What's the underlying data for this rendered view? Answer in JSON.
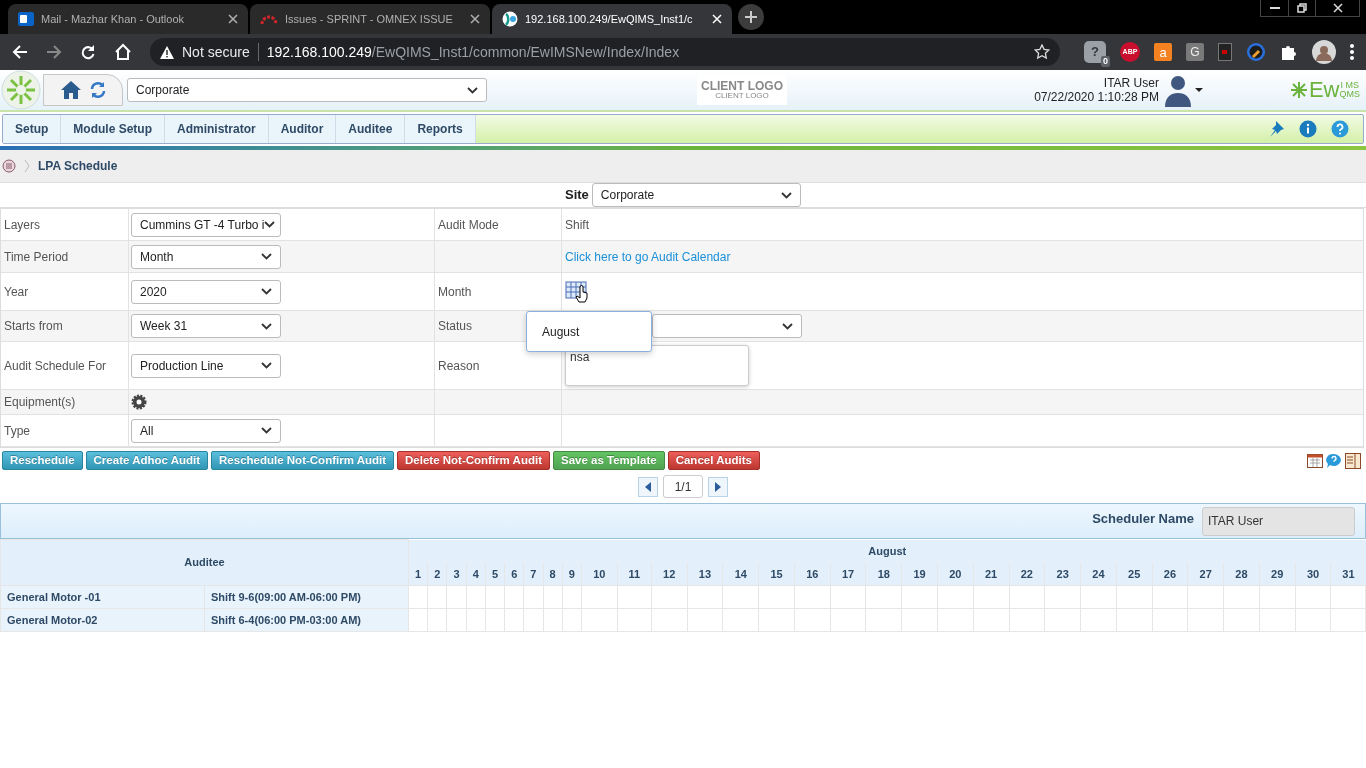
{
  "browser": {
    "tabs": [
      {
        "title": "Mail - Mazhar Khan - Outlook",
        "selected": false,
        "kind": "mail"
      },
      {
        "title": "Issues - SPRINT - OMNEX ISSUE",
        "selected": false,
        "kind": "gauge"
      },
      {
        "title": "192.168.100.249/EwQIMS_Inst1/c",
        "selected": true,
        "kind": "globe"
      }
    ],
    "security": "Not secure",
    "host": "192.168.100.249",
    "path": "/EwQIMS_Inst1/common/EwIMSNew/Index/Index",
    "extensions": [
      {
        "kind": "shield",
        "label": "?",
        "badge": "0"
      },
      {
        "kind": "red",
        "label": "ABP"
      },
      {
        "kind": "orange",
        "label": "a"
      },
      {
        "kind": "gray",
        "label": "G"
      },
      {
        "kind": "doc"
      },
      {
        "kind": "broom"
      },
      {
        "kind": "puzzle"
      },
      {
        "kind": "avatar"
      }
    ]
  },
  "header": {
    "site": "Corporate",
    "client_logo": "CLIENT LOGO",
    "client_logo_sub": "CLIENT LOGO",
    "user": "ITAR User",
    "datetime": "07/22/2020 1:10:28 PM",
    "brand": "Ew",
    "brand_top": "I MS",
    "brand_bottom": "QMS"
  },
  "menu": [
    "Setup",
    "Module Setup",
    "Administrator",
    "Auditor",
    "Auditee",
    "Reports"
  ],
  "breadcrumb": "LPA Schedule",
  "form": {
    "site_label": "Site",
    "site_value": "Corporate",
    "rows": [
      {
        "label": "Layers",
        "field": {
          "kind": "select",
          "value": "Cummins GT -4 Turbo i"
        },
        "label2": "Audit Mode",
        "field2": {
          "kind": "text",
          "value": "Shift"
        }
      },
      {
        "label": "Time Period",
        "field": {
          "kind": "select",
          "value": "Month"
        },
        "field2": {
          "kind": "link",
          "value": "Click here to go Audit Calendar"
        }
      },
      {
        "label": "Year",
        "field": {
          "kind": "select",
          "value": "2020"
        },
        "label2": "Month",
        "field2": {
          "kind": "calendar"
        }
      },
      {
        "label": "Starts from",
        "field": {
          "kind": "select",
          "value": "Week 31"
        },
        "label2": "Status",
        "field2": {
          "kind": "select"
        }
      },
      {
        "label": "Audit Schedule For",
        "field": {
          "kind": "select",
          "value": "Production Line"
        },
        "label2": "Reason",
        "field2": {
          "kind": "textarea",
          "value": "nsa"
        }
      },
      {
        "label": "Equipment(s)",
        "field": {
          "kind": "gear"
        }
      },
      {
        "label": "Type",
        "field": {
          "kind": "select",
          "value": "All"
        }
      }
    ],
    "month_popup": [
      "August"
    ]
  },
  "buttons": [
    {
      "label": "Reschedule",
      "kind": "info"
    },
    {
      "label": "Create Adhoc Audit",
      "kind": "info"
    },
    {
      "label": "Reschedule Not-Confirm Audit",
      "kind": "info"
    },
    {
      "label": "Delete Not-Confirm Audit",
      "kind": "danger"
    },
    {
      "label": "Save as Template",
      "kind": "success"
    },
    {
      "label": "Cancel Audits",
      "kind": "danger"
    }
  ],
  "pager": "1/1",
  "scheduler": {
    "label": "Scheduler Name",
    "value": "ITAR User"
  },
  "calendar": {
    "auditee_header": "Auditee",
    "month": "August",
    "days": [
      "1",
      "2",
      "3",
      "4",
      "5",
      "6",
      "7",
      "8",
      "9",
      "10",
      "11",
      "12",
      "13",
      "14",
      "15",
      "16",
      "17",
      "18",
      "19",
      "20",
      "21",
      "22",
      "23",
      "24",
      "25",
      "26",
      "27",
      "28",
      "29",
      "30",
      "31"
    ],
    "rows": [
      {
        "name": "General Motor -01",
        "shift": "Shift 9-6(09:00 AM-06:00 PM)"
      },
      {
        "name": "General Motor-02",
        "shift": "Shift 6-4(06:00 PM-03:00 AM)"
      }
    ]
  }
}
